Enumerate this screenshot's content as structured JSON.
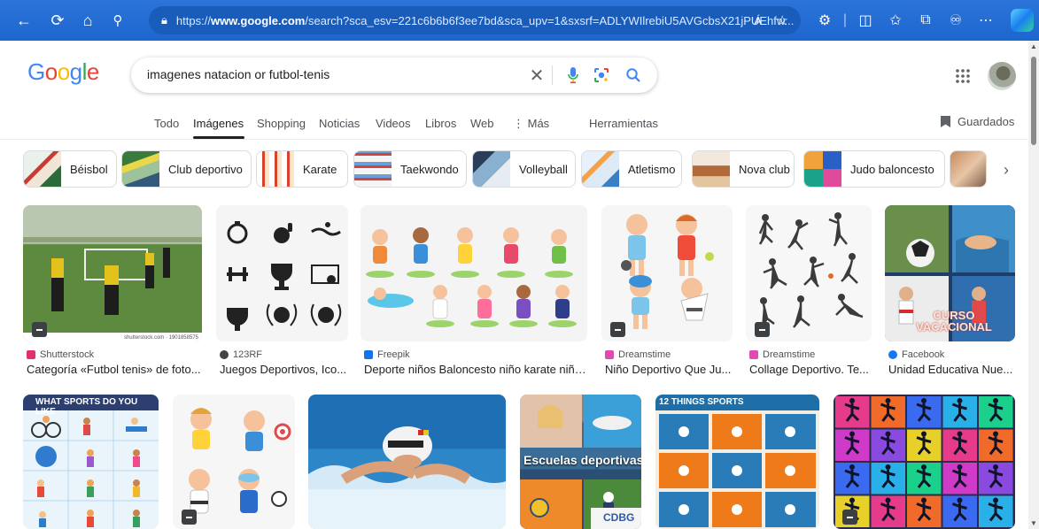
{
  "browser": {
    "url_prefix": "https://",
    "url_host": "www.google.com",
    "url_rest": "/search?sca_esv=221c6b6b6f3ee7bd&sca_upv=1&sxsrf=ADLYWIlrebiU5AVGcbsX21jPUEhfw...",
    "read_aloud": "Á"
  },
  "google": {
    "logo": [
      "G",
      "o",
      "o",
      "g",
      "l",
      "e"
    ],
    "logo_colors": [
      "#4285F4",
      "#EA4335",
      "#FBBC05",
      "#4285F4",
      "#34A853",
      "#EA4335"
    ],
    "query": "imagenes natacion or futbol-tenis"
  },
  "tabs": [
    "Todo",
    "Imágenes",
    "Shopping",
    "Noticias",
    "Videos",
    "Libros",
    "Web"
  ],
  "more_label": "⋮ Más",
  "tools_label": "Herramientas",
  "saved_label": "Guardados",
  "chips": [
    "Béisbol",
    "Club deportivo",
    "Karate",
    "Taekwondo",
    "Volleyball",
    "Atletismo",
    "Nova club",
    "Judo baloncesto"
  ],
  "results_row1": [
    {
      "source": "Shutterstock",
      "title": "Categoría «Futbol tenis» de foto...",
      "fav": "#e1306c",
      "watermark": "shutterstock.com · 1901858575"
    },
    {
      "source": "123RF",
      "title": "Juegos Deportivos, Ico...",
      "fav": "#444444"
    },
    {
      "source": "Freepik",
      "title": "Deporte niños Baloncesto niño karate niño...",
      "fav": "#1273eb"
    },
    {
      "source": "Dreamstime",
      "title": "Niño Deportivo Que Ju...",
      "fav": "#e14ab5"
    },
    {
      "source": "Dreamstime",
      "title": "Collage Deportivo. Te...",
      "fav": "#e14ab5"
    },
    {
      "source": "Facebook",
      "title": "Unidad Educativa Nue...",
      "fav": "#1877f2",
      "overlay": "CURSO VACACIONAL"
    }
  ],
  "results_row2": [
    {
      "overlay": "WHAT SPORTS DO YOU LIKE"
    },
    {},
    {},
    {
      "overlay": "Escuelas deportivas",
      "overlay2": "CDBG"
    },
    {
      "overlay": "12 THINGS SPORTS"
    },
    {}
  ]
}
